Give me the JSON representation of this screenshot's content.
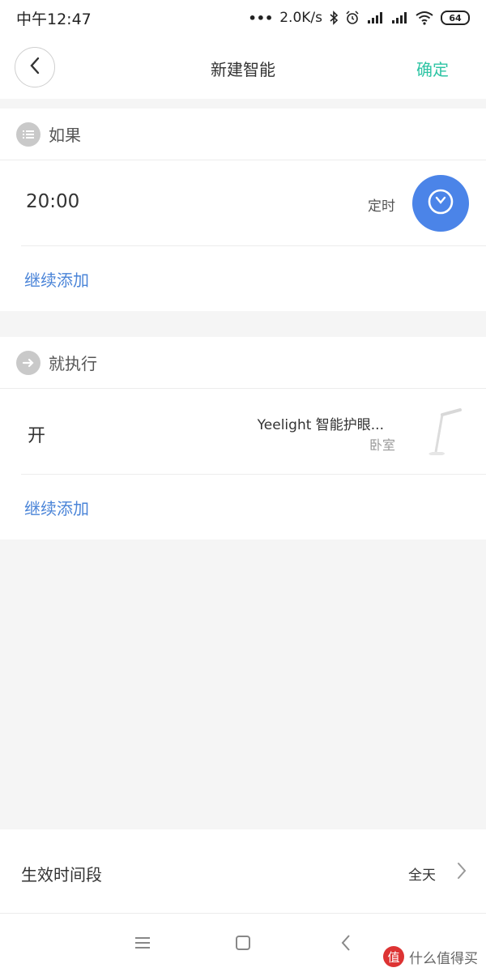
{
  "status_bar": {
    "time": "中午12:47",
    "dots": "•••",
    "speed": "2.0K/s",
    "battery": "64"
  },
  "header": {
    "title": "新建智能",
    "confirm_label": "确定"
  },
  "if_section": {
    "heading": "如果",
    "condition": {
      "value": "20:00",
      "type": "定时"
    },
    "add_label": "继续添加"
  },
  "then_section": {
    "heading": "就执行",
    "action": {
      "label": "开",
      "device_name": "Yeelight 智能护眼...",
      "room": "卧室"
    },
    "add_label": "继续添加"
  },
  "period": {
    "label": "生效时间段",
    "value": "全天"
  },
  "watermark": {
    "badge": "值",
    "text": "什么值得买"
  },
  "colors": {
    "accent": "#2ec4a4",
    "link": "#4a84d8",
    "clock_button": "#4b84e8"
  }
}
